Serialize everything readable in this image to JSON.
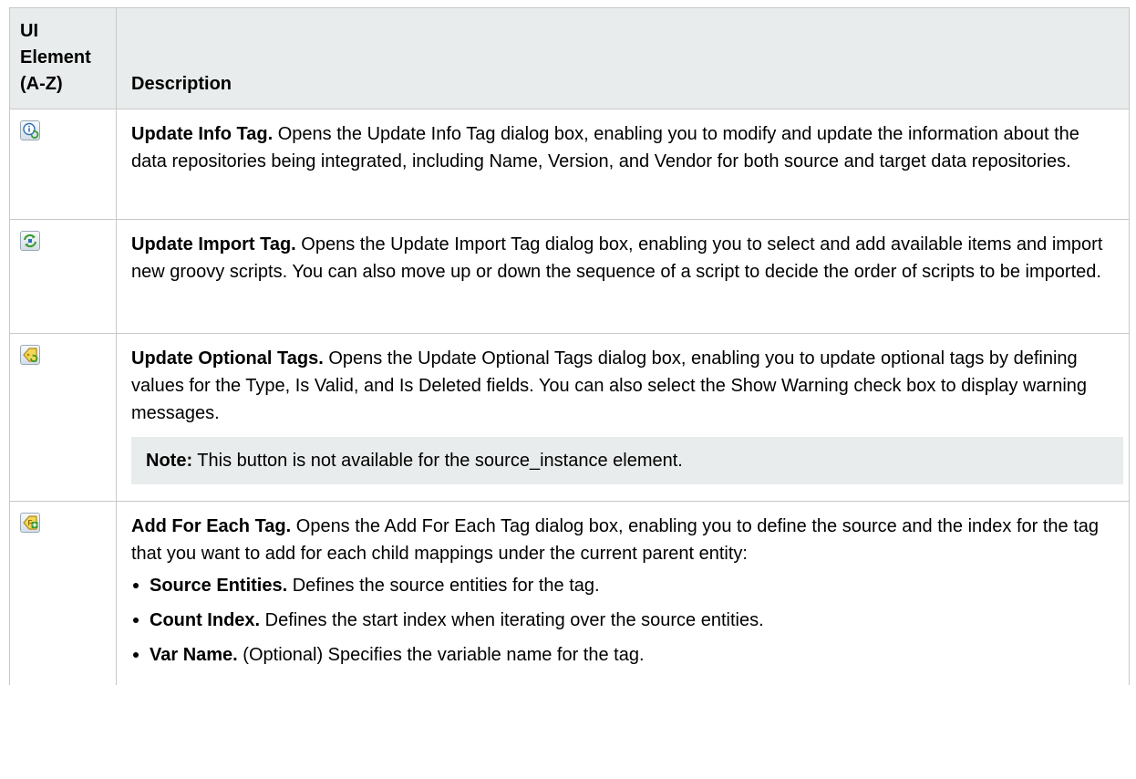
{
  "table": {
    "header": {
      "col1": "UI Element (A-Z)",
      "col2": "Description"
    },
    "rows": [
      {
        "icon": "update-info-tag-icon",
        "title": "Update Info Tag.",
        "text": " Opens the Update Info Tag dialog box, enabling you to modify and update the information about the data repositories being integrated, including Name, Version, and Vendor for both source and target data repositories."
      },
      {
        "icon": "update-import-tag-icon",
        "title": "Update Import Tag.",
        "text": " Opens the Update Import Tag dialog box, enabling you to select and add available items and import new groovy scripts. You can also move up or down the sequence of a script to decide the order of scripts to be imported."
      },
      {
        "icon": "update-optional-tags-icon",
        "title": "Update Optional Tags.",
        "text": " Opens the Update Optional Tags dialog box, enabling you to update optional tags by defining values for the Type, Is Valid, and Is Deleted fields. You can also select the Show Warning check box to display warning messages.",
        "note": {
          "label": "Note:",
          "text": " This button is not available for the source_instance element."
        }
      },
      {
        "icon": "add-for-each-tag-icon",
        "title": "Add For Each Tag.",
        "text": " Opens the Add For Each Tag dialog box, enabling you to define the source and the index for the tag that you want to add for each child mappings under the current parent entity:",
        "bullets": [
          {
            "title": "Source Entities.",
            "text": " Defines the source entities for the tag."
          },
          {
            "title": "Count Index.",
            "text": " Defines the start index when iterating over the source entities."
          },
          {
            "title": "Var Name.",
            "text": " (Optional) Specifies the variable name for the tag."
          }
        ]
      }
    ]
  }
}
